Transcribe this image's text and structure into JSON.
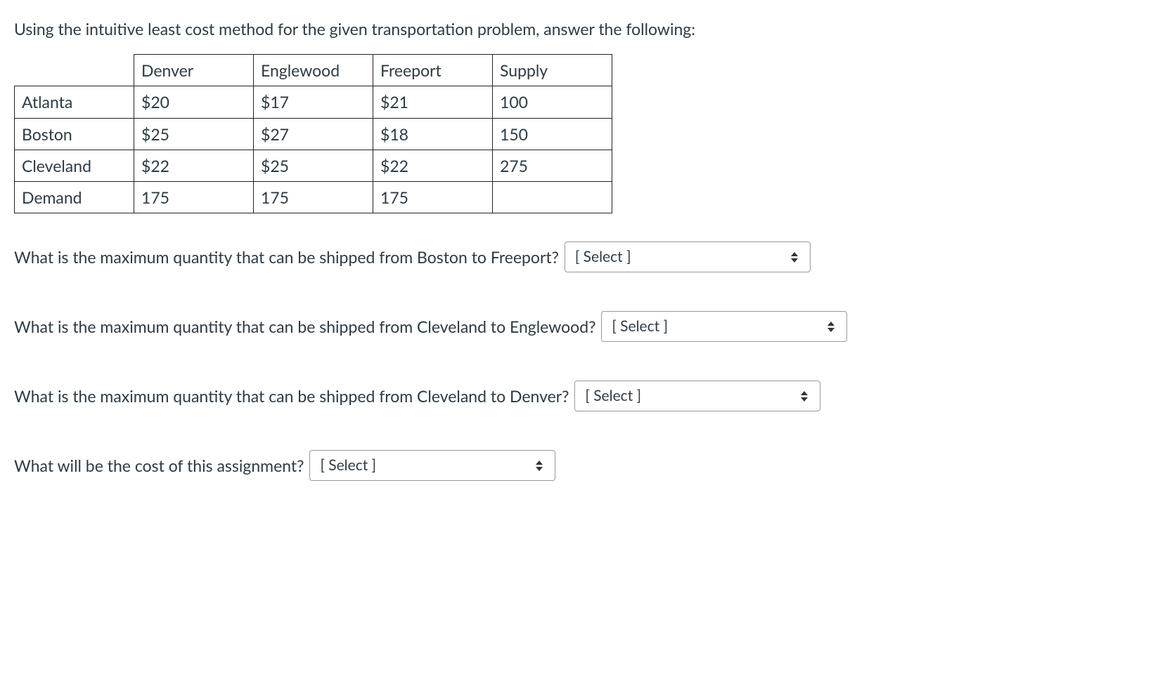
{
  "intro": "Using the intuitive least cost method for the given transportation problem, answer the following:",
  "table": {
    "headers": [
      "Denver",
      "Englewood",
      "Freeport",
      "Supply"
    ],
    "rows": [
      {
        "label": "Atlanta",
        "cells": [
          "$20",
          "$17",
          "$21",
          "100"
        ]
      },
      {
        "label": "Boston",
        "cells": [
          "$25",
          "$27",
          "$18",
          "150"
        ]
      },
      {
        "label": "Cleveland",
        "cells": [
          "$22",
          "$25",
          "$22",
          "275"
        ]
      },
      {
        "label": "Demand",
        "cells": [
          "175",
          "175",
          "175",
          ""
        ]
      }
    ]
  },
  "questions": [
    {
      "text": "What is the maximum quantity that can be shipped from Boston to Freeport?",
      "select_label": "[ Select ]",
      "select_width": 370
    },
    {
      "text": "What is the maximum quantity that can be shipped from Cleveland to Englewood?",
      "select_label": "[ Select ]",
      "select_width": 370
    },
    {
      "text": "What is the maximum quantity that can be shipped from Cleveland to Denver?",
      "select_label": "[ Select ]",
      "select_width": 370
    },
    {
      "text": "What will be the cost of this assignment?",
      "select_label": "[ Select ]",
      "select_width": 370
    }
  ]
}
